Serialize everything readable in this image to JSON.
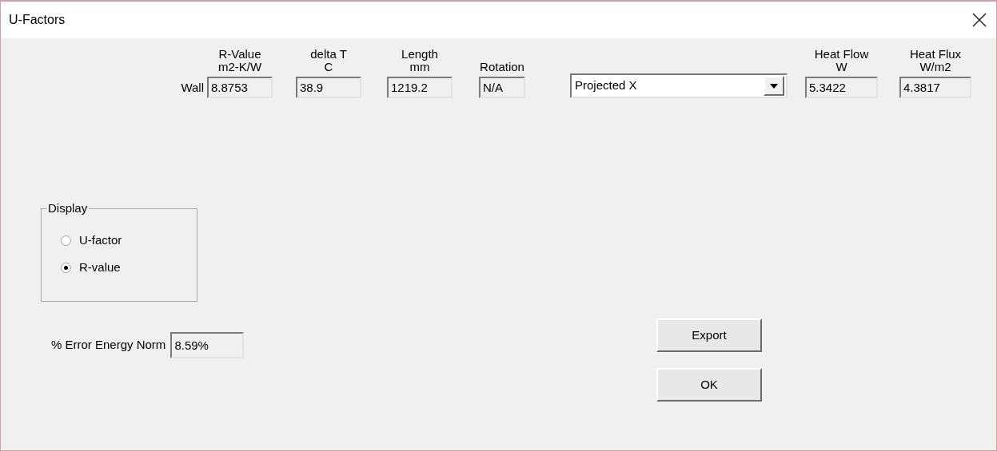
{
  "window": {
    "title": "U-Factors"
  },
  "row_label": "Wall",
  "columns": [
    {
      "kind": "field",
      "header": [
        "R-Value",
        "m2-K/W"
      ],
      "value": "8.8753"
    },
    {
      "kind": "field",
      "header": [
        "delta T",
        "C"
      ],
      "value": "38.9"
    },
    {
      "kind": "field",
      "header": [
        "Length",
        "mm"
      ],
      "value": "1219.2"
    },
    {
      "kind": "field",
      "header": [
        "Rotation"
      ],
      "value": "N/A"
    },
    {
      "kind": "dropdown",
      "value": "Projected X"
    },
    {
      "kind": "field",
      "header": [
        "Heat Flow",
        "W"
      ],
      "value": "5.3422"
    },
    {
      "kind": "field",
      "header": [
        "Heat Flux",
        "W/m2"
      ],
      "value": "4.3817"
    }
  ],
  "display_group": {
    "title": "Display",
    "options": [
      {
        "label": "U-factor",
        "selected": false
      },
      {
        "label": "R-value",
        "selected": true
      }
    ]
  },
  "error_norm": {
    "label": "% Error Energy Norm",
    "value": "8.59%"
  },
  "buttons": [
    "Export",
    "OK"
  ]
}
